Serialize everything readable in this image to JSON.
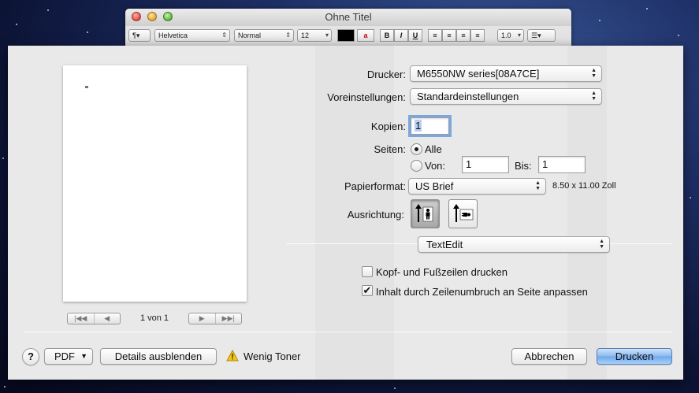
{
  "background_window": {
    "title": "Ohne Titel",
    "toolbar": {
      "paragraph_style": "¶▾",
      "font_family": "Helvetica",
      "font_style": "Normal",
      "font_size": "12",
      "bold": "B",
      "italic": "I",
      "underline": "U",
      "line_spacing": "1.0",
      "list": "☰▾"
    }
  },
  "print_dialog": {
    "preview": {
      "page_counter": "1 von 1"
    },
    "printer": {
      "label": "Drucker:",
      "value": "M6550NW series[08A7CE]"
    },
    "presets": {
      "label": "Voreinstellungen:",
      "value": "Standardeinstellungen"
    },
    "copies": {
      "label": "Kopien:",
      "value": "1"
    },
    "pages": {
      "label": "Seiten:",
      "all_label": "Alle",
      "from_label": "Von:",
      "from_value": "1",
      "to_label": "Bis:",
      "to_value": "1",
      "selected": "all"
    },
    "paper_size": {
      "label": "Papierformat:",
      "value": "US Brief",
      "dimensions": "8.50 x 11.00 Zoll"
    },
    "orientation": {
      "label": "Ausrichtung:",
      "selected": "portrait"
    },
    "section_menu": {
      "value": "TextEdit"
    },
    "options": [
      {
        "label": "Kopf- und Fußzeilen drucken",
        "checked": false
      },
      {
        "label": "Inhalt durch Zeilenumbruch an Seite anpassen",
        "checked": true
      }
    ],
    "footer": {
      "help": "?",
      "pdf": "PDF",
      "details": "Details ausblenden",
      "warning": "Wenig Toner",
      "cancel": "Abbrechen",
      "print": "Drucken"
    }
  },
  "colors": {
    "desktop": "#1e2f66",
    "sheet": "#e9e9e9",
    "default_button": "#6fa7ea",
    "focus_ring": "#7aa7e0",
    "warning": "#f3c61a"
  }
}
